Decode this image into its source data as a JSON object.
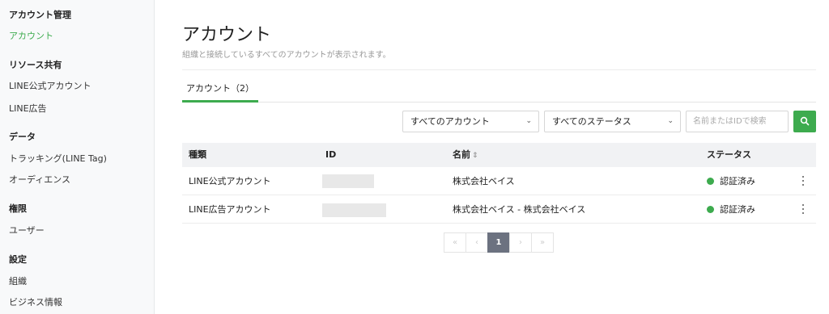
{
  "sidebar": {
    "groups": [
      {
        "title": "アカウント管理",
        "items": [
          {
            "label": "アカウント",
            "active": true
          }
        ]
      },
      {
        "title": "リソース共有",
        "items": [
          {
            "label": "LINE公式アカウント"
          },
          {
            "label": "LINE広告"
          }
        ]
      },
      {
        "title": "データ",
        "items": [
          {
            "label": "トラッキング(LINE Tag)"
          },
          {
            "label": "オーディエンス"
          }
        ]
      },
      {
        "title": "権限",
        "items": [
          {
            "label": "ユーザー"
          }
        ]
      },
      {
        "title": "設定",
        "items": [
          {
            "label": "組織"
          },
          {
            "label": "ビジネス情報"
          }
        ]
      }
    ]
  },
  "main": {
    "title": "アカウント",
    "subtitle": "組織と接続しているすべてのアカウントが表示されます。",
    "tab_label": "アカウント（2）",
    "filters": {
      "account_select": "すべてのアカウント",
      "status_select": "すべてのステータス",
      "search_placeholder": "名前またはIDで検索"
    },
    "table": {
      "headers": {
        "type": "種類",
        "id": "ID",
        "name": "名前",
        "sort_glyph": "⇕",
        "status": "ステータス"
      },
      "rows": [
        {
          "type": "LINE公式アカウント",
          "name": "株式会社ベイス",
          "status": "認証済み"
        },
        {
          "type": "LINE広告アカウント",
          "name": "株式会社ベイス - 株式会社ベイス",
          "status": "認証済み"
        }
      ]
    },
    "pagination": {
      "first": "«",
      "prev": "‹",
      "current": "1",
      "next": "›",
      "last": "»"
    }
  },
  "colors": {
    "accent": "#3dab4e",
    "status_verified": "#3dab4e",
    "page_current_bg": "#6c7280"
  },
  "icons": {
    "search": "search-icon",
    "chevron": "chevron-down-icon",
    "kebab": "kebab-menu-icon"
  }
}
